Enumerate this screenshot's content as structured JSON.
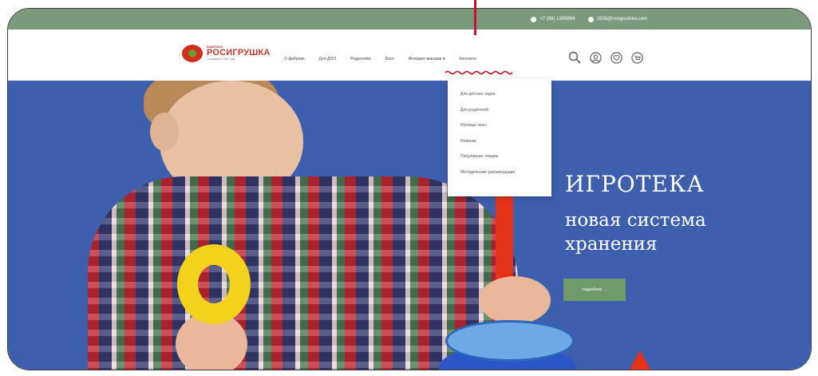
{
  "topbar": {
    "contacts": [
      {
        "icon": "phone-icon",
        "text": "+7 (99) 1305894"
      },
      {
        "icon": "mail-icon",
        "text": "1939@rosigrushka.com"
      }
    ]
  },
  "logo": {
    "top_text": "ФАБРИКА",
    "brand": "РОСИГРУШКА",
    "tagline": "Основана в 1987 году"
  },
  "nav": {
    "items": [
      {
        "label": "О фабрике"
      },
      {
        "label": "Для ДОО"
      },
      {
        "label": "Родителям"
      },
      {
        "label": "Блог"
      },
      {
        "label": "Интернет-магазин ▾",
        "active": true
      },
      {
        "label": "Контакты"
      }
    ],
    "icons": [
      "search-icon",
      "account-icon",
      "favorites-icon",
      "cart-icon"
    ]
  },
  "dropdown": {
    "items": [
      {
        "label": "Для детских садов"
      },
      {
        "label": "Для родителей"
      },
      {
        "label": "Игровые зоны"
      },
      {
        "label": "Новинки"
      },
      {
        "label": "Популярные товары"
      },
      {
        "label": "Методические рекомендации"
      }
    ]
  },
  "hero": {
    "title": "ИГРОТЕКА",
    "subtitle_line1": "новая система",
    "subtitle_line2": "хранения",
    "button": "подробнее →"
  },
  "colors": {
    "topbar": "#7b9a7c",
    "hero_bg": "#3d5fae",
    "brand_red": "#c0392b",
    "button": "#6f9b6b",
    "annotation": "#c8102e"
  }
}
